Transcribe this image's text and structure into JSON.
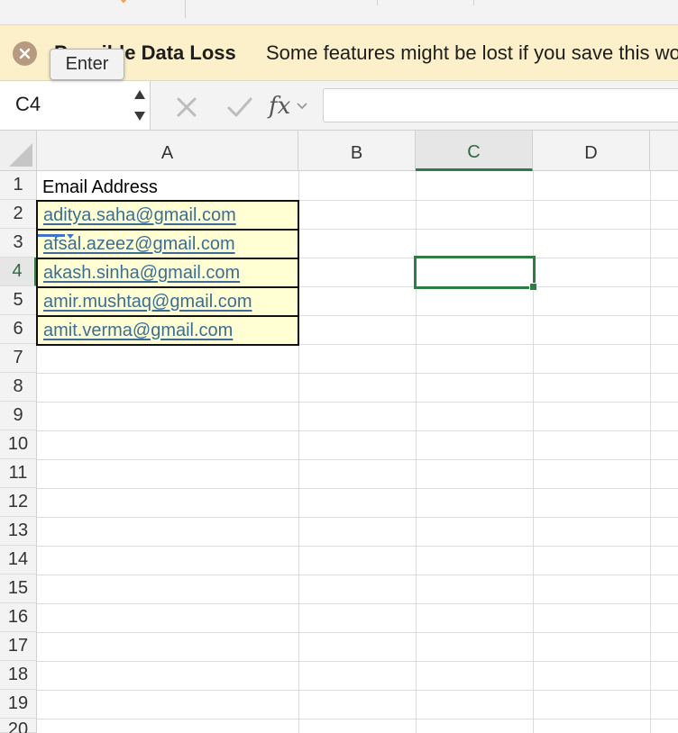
{
  "message_bar": {
    "title": "Possible Data Loss",
    "message": "Some features might be lost if you save this workbook in the comma-delimited (.csv) format."
  },
  "tooltip": {
    "text": "Enter"
  },
  "formula_bar": {
    "name_box": "C4",
    "fx_label": "fx",
    "formula": ""
  },
  "grid": {
    "columns": [
      "A",
      "B",
      "C",
      "D"
    ],
    "active_column": "C",
    "rows": [
      "1",
      "2",
      "3",
      "4",
      "5",
      "6",
      "7",
      "8",
      "9",
      "10",
      "11",
      "12",
      "13",
      "14",
      "15",
      "16",
      "17",
      "18",
      "19",
      "20"
    ],
    "active_row": "4",
    "selected_cell": "C4"
  },
  "cells": {
    "header": "Email Address",
    "emails": [
      "aditya.saha@gmail.com",
      "afsal.azeez@gmail.com",
      "akash.sinha@gmail.com",
      "amir.mushtaq@gmail.com",
      "amit.verma@gmail.com"
    ]
  },
  "colors": {
    "accent_green": "#2e7d45",
    "hyperlink": "#3a6e96",
    "cell_fill": "#ffffd3",
    "message_bar_bg": "#fbf0c9"
  },
  "icons": {
    "close": "close-circle-icon",
    "cancel": "x-icon",
    "confirm": "checkmark-icon",
    "function": "fx-icon",
    "spinner": "up-down-spinner-icon"
  }
}
